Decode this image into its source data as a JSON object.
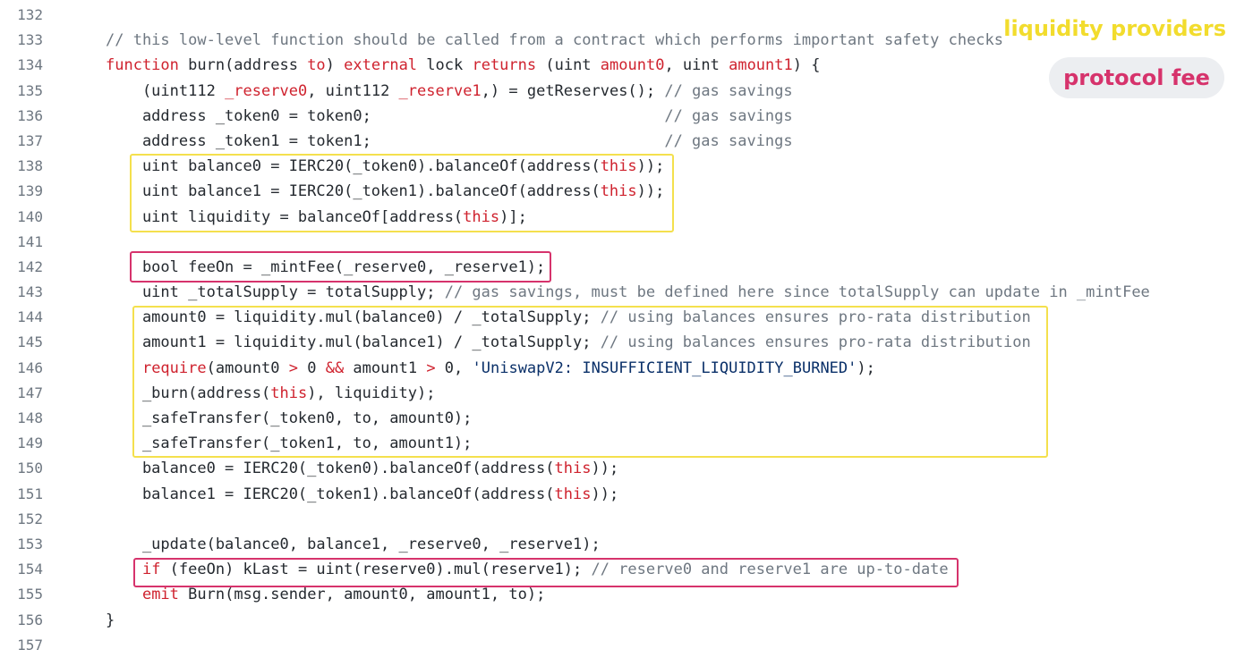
{
  "legend": {
    "liquidity_providers": "liquidity providers",
    "protocol_fee": "protocol fee",
    "colors": {
      "liquidity_providers": "#f2dc2d",
      "protocol_fee": "#d6336c"
    }
  },
  "code": {
    "lines": [
      {
        "n": "132",
        "tokens": []
      },
      {
        "n": "133",
        "tokens": [
          {
            "t": "// this low-level function should be called from a contract which performs important safety checks",
            "c": "c"
          }
        ]
      },
      {
        "n": "134",
        "tokens": [
          {
            "t": "function",
            "c": "k"
          },
          {
            "t": " burn(address "
          },
          {
            "t": "to",
            "c": "k"
          },
          {
            "t": ") "
          },
          {
            "t": "external",
            "c": "k"
          },
          {
            "t": " lock "
          },
          {
            "t": "returns",
            "c": "k"
          },
          {
            "t": " (uint "
          },
          {
            "t": "amount0",
            "c": "k"
          },
          {
            "t": ", uint "
          },
          {
            "t": "amount1",
            "c": "k"
          },
          {
            "t": ") {"
          }
        ]
      },
      {
        "n": "135",
        "tokens": [
          {
            "t": "    (uint112 "
          },
          {
            "t": "_reserve0",
            "c": "k"
          },
          {
            "t": ", uint112 "
          },
          {
            "t": "_reserve1",
            "c": "k"
          },
          {
            "t": ",) = getReserves(); "
          },
          {
            "t": "// gas savings",
            "c": "c"
          }
        ]
      },
      {
        "n": "136",
        "tokens": [
          {
            "t": "    address _token0 = token0;                                "
          },
          {
            "t": "// gas savings",
            "c": "c"
          }
        ]
      },
      {
        "n": "137",
        "tokens": [
          {
            "t": "    address _token1 = token1;                                "
          },
          {
            "t": "// gas savings",
            "c": "c"
          }
        ]
      },
      {
        "n": "138",
        "tokens": [
          {
            "t": "    uint balance0 = IERC20(_token0).balanceOf(address("
          },
          {
            "t": "this",
            "c": "k"
          },
          {
            "t": "));"
          }
        ]
      },
      {
        "n": "139",
        "tokens": [
          {
            "t": "    uint balance1 = IERC20(_token1).balanceOf(address("
          },
          {
            "t": "this",
            "c": "k"
          },
          {
            "t": "));"
          }
        ]
      },
      {
        "n": "140",
        "tokens": [
          {
            "t": "    uint liquidity = balanceOf[address("
          },
          {
            "t": "this",
            "c": "k"
          },
          {
            "t": ")];"
          }
        ]
      },
      {
        "n": "141",
        "tokens": []
      },
      {
        "n": "142",
        "tokens": [
          {
            "t": "    bool feeOn = _mintFee(_reserve0, _reserve1);"
          }
        ]
      },
      {
        "n": "143",
        "tokens": [
          {
            "t": "    uint _totalSupply = totalSupply; "
          },
          {
            "t": "// gas savings, must be defined here since totalSupply can update in _mintFee",
            "c": "c"
          }
        ]
      },
      {
        "n": "144",
        "tokens": [
          {
            "t": "    amount0 = liquidity.mul(balance0) / _totalSupply; "
          },
          {
            "t": "// using balances ensures pro-rata distribution",
            "c": "c"
          }
        ]
      },
      {
        "n": "145",
        "tokens": [
          {
            "t": "    amount1 = liquidity.mul(balance1) / _totalSupply; "
          },
          {
            "t": "// using balances ensures pro-rata distribution",
            "c": "c"
          }
        ]
      },
      {
        "n": "146",
        "tokens": [
          {
            "t": "    "
          },
          {
            "t": "require",
            "c": "k"
          },
          {
            "t": "(amount0 "
          },
          {
            "t": ">",
            "c": "k"
          },
          {
            "t": " 0 "
          },
          {
            "t": "&&",
            "c": "k"
          },
          {
            "t": " amount1 "
          },
          {
            "t": ">",
            "c": "k"
          },
          {
            "t": " 0, "
          },
          {
            "t": "'UniswapV2: INSUFFICIENT_LIQUIDITY_BURNED'",
            "c": "s"
          },
          {
            "t": ");"
          }
        ]
      },
      {
        "n": "147",
        "tokens": [
          {
            "t": "    _burn(address("
          },
          {
            "t": "this",
            "c": "k"
          },
          {
            "t": "), liquidity);"
          }
        ]
      },
      {
        "n": "148",
        "tokens": [
          {
            "t": "    _safeTransfer(_token0, to, amount0);"
          }
        ]
      },
      {
        "n": "149",
        "tokens": [
          {
            "t": "    _safeTransfer(_token1, to, amount1);"
          }
        ]
      },
      {
        "n": "150",
        "tokens": [
          {
            "t": "    balance0 = IERC20(_token0).balanceOf(address("
          },
          {
            "t": "this",
            "c": "k"
          },
          {
            "t": "));"
          }
        ]
      },
      {
        "n": "151",
        "tokens": [
          {
            "t": "    balance1 = IERC20(_token1).balanceOf(address("
          },
          {
            "t": "this",
            "c": "k"
          },
          {
            "t": "));"
          }
        ]
      },
      {
        "n": "152",
        "tokens": []
      },
      {
        "n": "153",
        "tokens": [
          {
            "t": "    _update(balance0, balance1, _reserve0, _reserve1);"
          }
        ]
      },
      {
        "n": "154",
        "tokens": [
          {
            "t": "    "
          },
          {
            "t": "if",
            "c": "k"
          },
          {
            "t": " (feeOn) kLast = uint(reserve0).mul(reserve1); "
          },
          {
            "t": "// reserve0 and reserve1 are up-to-date",
            "c": "c"
          }
        ]
      },
      {
        "n": "155",
        "tokens": [
          {
            "t": "    "
          },
          {
            "t": "emit",
            "c": "k"
          },
          {
            "t": " Burn(msg.sender, amount0, amount1, to);"
          }
        ]
      },
      {
        "n": "156",
        "tokens": [
          {
            "t": "}"
          }
        ]
      },
      {
        "n": "157",
        "tokens": []
      }
    ]
  }
}
